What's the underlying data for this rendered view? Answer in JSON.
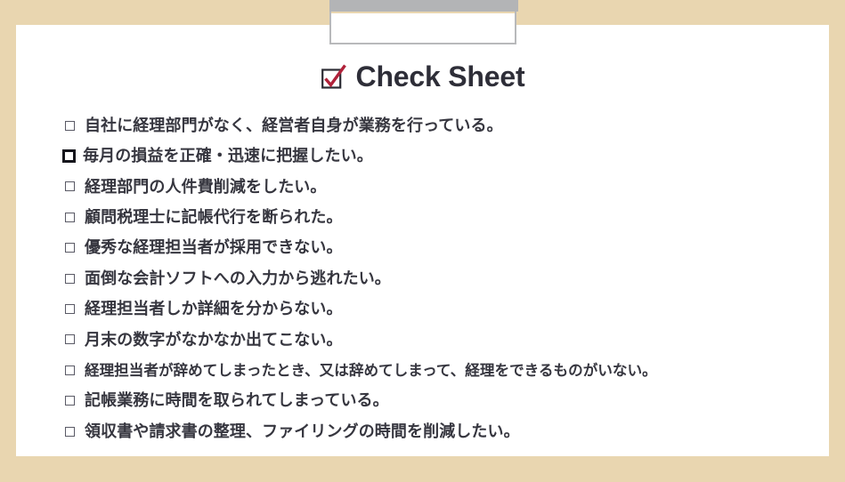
{
  "colors": {
    "frame_beige": "#e9d6b0",
    "page_white": "#ffffff",
    "text_dark": "#36363f",
    "title_dark": "#2e2e38",
    "check_red": "#b0223a",
    "widget_gray": "#b3b4b6",
    "checkbox_border": "#5a5a66"
  },
  "top_widget": {
    "bar_label": "gray-title-bar",
    "box_label": "empty-placeholder-box"
  },
  "title": {
    "icon": "checked-checkbox-icon",
    "text": "Check Sheet"
  },
  "checklist": {
    "items": [
      {
        "checkbox": "unchecked-checkbox-icon",
        "emphasis": false,
        "small": false,
        "text": "自社に経理部門がなく、経営者自身が業務を行っている。"
      },
      {
        "checkbox": "unchecked-checkbox-icon-bold",
        "emphasis": true,
        "small": false,
        "text": "毎月の損益を正確・迅速に把握したい。"
      },
      {
        "checkbox": "unchecked-checkbox-icon",
        "emphasis": false,
        "small": false,
        "text": "経理部門の人件費削減をしたい。"
      },
      {
        "checkbox": "unchecked-checkbox-icon",
        "emphasis": false,
        "small": false,
        "text": "顧問税理士に記帳代行を断られた。"
      },
      {
        "checkbox": "unchecked-checkbox-icon",
        "emphasis": false,
        "small": false,
        "text": "優秀な経理担当者が採用できない。"
      },
      {
        "checkbox": "unchecked-checkbox-icon",
        "emphasis": false,
        "small": false,
        "text": "面倒な会計ソフトへの入力から逃れたい。"
      },
      {
        "checkbox": "unchecked-checkbox-icon",
        "emphasis": false,
        "small": false,
        "text": "経理担当者しか詳細を分からない。"
      },
      {
        "checkbox": "unchecked-checkbox-icon",
        "emphasis": false,
        "small": false,
        "text": "月末の数字がなかなか出てこない。"
      },
      {
        "checkbox": "unchecked-checkbox-icon",
        "emphasis": false,
        "small": true,
        "text": "経理担当者が辞めてしまったとき、又は辞めてしまって、経理をできるものがいない。"
      },
      {
        "checkbox": "unchecked-checkbox-icon",
        "emphasis": false,
        "small": false,
        "text": "記帳業務に時間を取られてしまっている。"
      },
      {
        "checkbox": "unchecked-checkbox-icon",
        "emphasis": false,
        "small": false,
        "text": "領収書や請求書の整理、ファイリングの時間を削減したい。"
      }
    ]
  }
}
